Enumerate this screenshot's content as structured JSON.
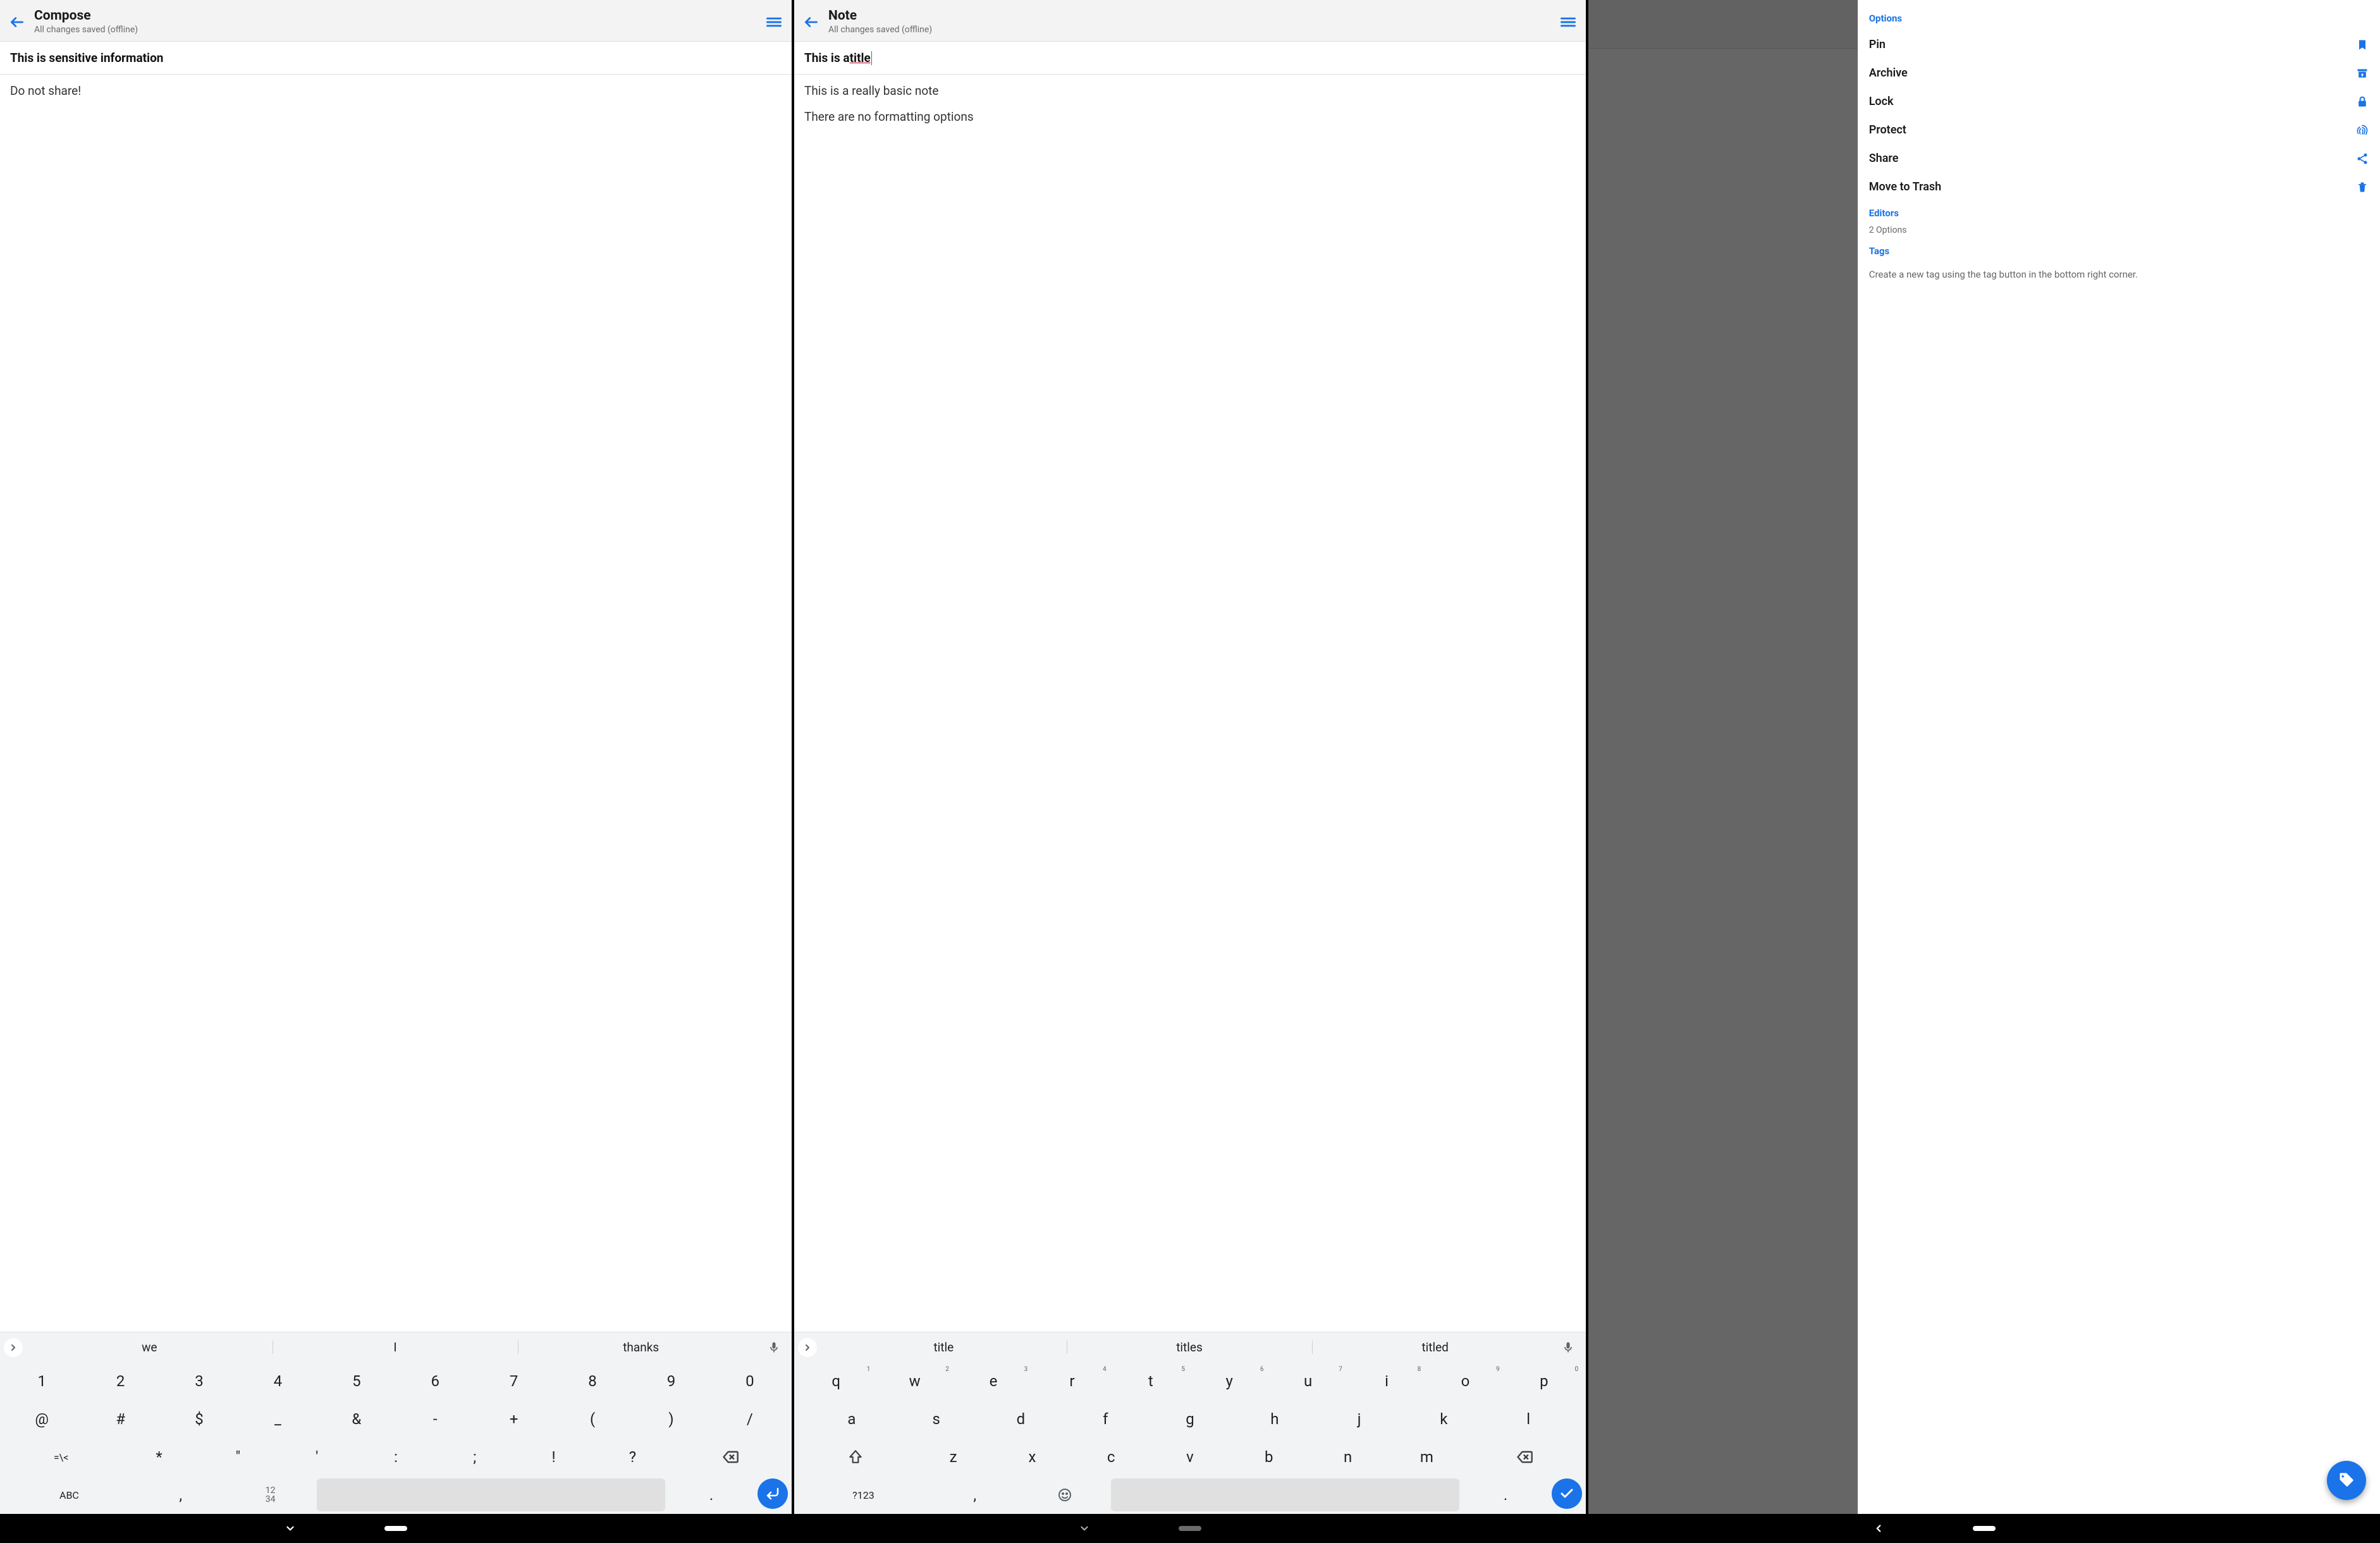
{
  "screen1": {
    "header": {
      "title": "Compose",
      "subtitle": "All changes saved (offline)"
    },
    "note_title": "This is sensitive information",
    "body": [
      "Do not share!"
    ],
    "suggestions": [
      "we",
      "I",
      "thanks"
    ],
    "kb": {
      "row1": [
        "1",
        "2",
        "3",
        "4",
        "5",
        "6",
        "7",
        "8",
        "9",
        "0"
      ],
      "row2": [
        "@",
        "#",
        "$",
        "_",
        "&",
        "-",
        "+",
        "(",
        ")",
        "/"
      ],
      "row3": [
        "=\\<",
        "*",
        "\"",
        "'",
        ":",
        ";",
        "!",
        "?"
      ],
      "row4_left": "ABC",
      "row4_comma": ",",
      "row4_nums": "12\n34",
      "row4_period": "."
    }
  },
  "screen2": {
    "header": {
      "title": "Note",
      "subtitle": "All changes saved (offline)"
    },
    "note_title_pre": "This is a ",
    "note_title_u": "title",
    "body": [
      "This is a really basic note",
      "There are no formatting options"
    ],
    "suggestions": [
      "title",
      "titles",
      "titled"
    ],
    "kb": {
      "row1": [
        "q",
        "w",
        "e",
        "r",
        "t",
        "y",
        "u",
        "i",
        "o",
        "p"
      ],
      "row1s": [
        "1",
        "2",
        "3",
        "4",
        "5",
        "6",
        "7",
        "8",
        "9",
        "0"
      ],
      "row2": [
        "a",
        "s",
        "d",
        "f",
        "g",
        "h",
        "j",
        "k",
        "l"
      ],
      "row3": [
        "z",
        "x",
        "c",
        "v",
        "b",
        "n",
        "m"
      ],
      "row4_left": "?123",
      "row4_comma": ",",
      "row4_period": "."
    }
  },
  "screen3": {
    "sections": {
      "options_label": "Options",
      "options": [
        {
          "label": "Pin",
          "icon": "bookmark-icon"
        },
        {
          "label": "Archive",
          "icon": "archive-icon"
        },
        {
          "label": "Lock",
          "icon": "lock-icon"
        },
        {
          "label": "Protect",
          "icon": "fingerprint-icon"
        },
        {
          "label": "Share",
          "icon": "share-icon"
        },
        {
          "label": "Move to Trash",
          "icon": "trash-icon"
        }
      ],
      "editors_label": "Editors",
      "editors_sub": "2 Options",
      "tags_label": "Tags",
      "tags_hint": "Create a new tag using the tag button in the bottom right corner."
    }
  }
}
